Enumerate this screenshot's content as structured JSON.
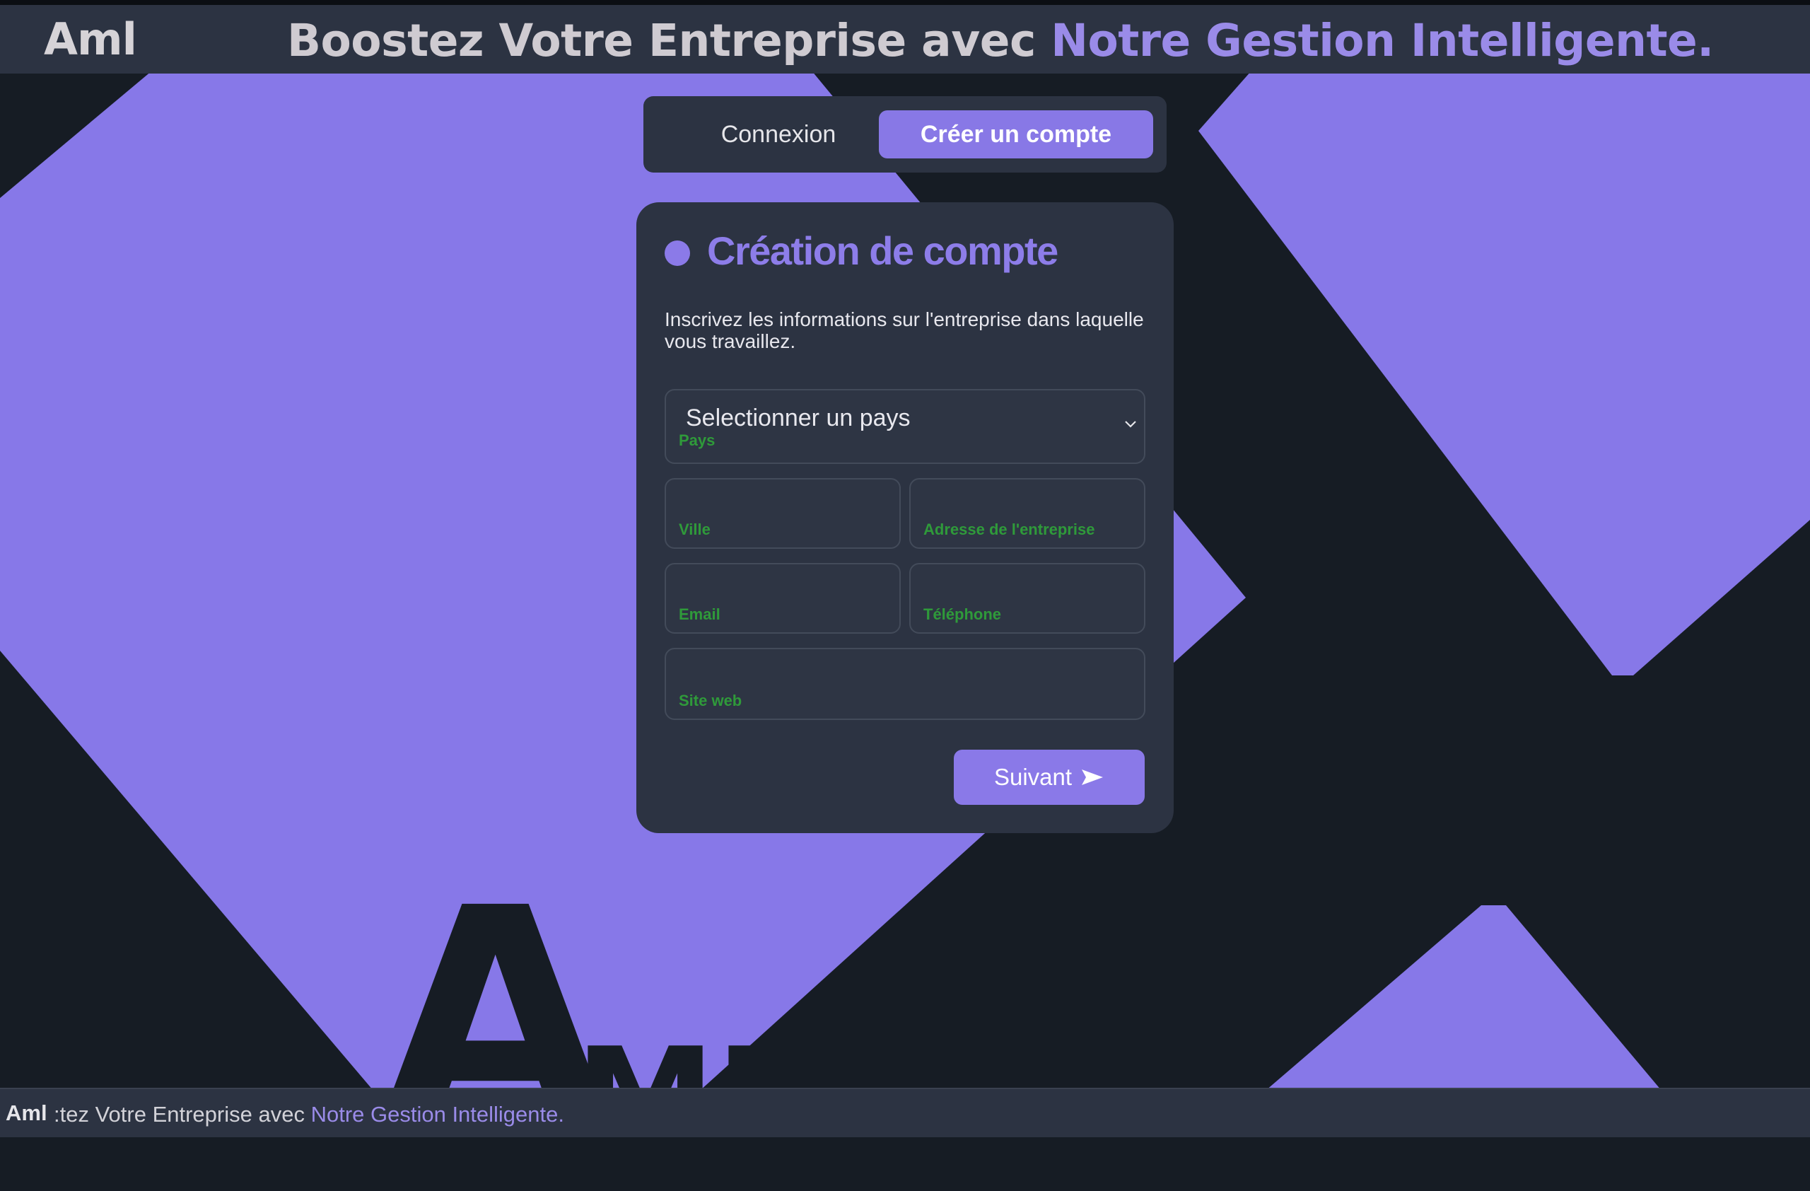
{
  "header": {
    "brand": "Aml",
    "headline_plain": "Boostez Votre Entreprise avec ",
    "headline_accent": "Notre Gestion Intelligente."
  },
  "tabs": [
    {
      "label": "Connexion",
      "active": false
    },
    {
      "label": "Créer un compte",
      "active": true
    }
  ],
  "form": {
    "title": "Création de compte",
    "description": "Inscrivez les informations sur l'entreprise dans laquelle vous travaillez.",
    "country": {
      "value": "Selectionner un pays",
      "label": "Pays"
    },
    "city": {
      "label": "Ville",
      "value": ""
    },
    "address": {
      "label": "Adresse de l'entreprise",
      "value": ""
    },
    "email": {
      "label": "Email",
      "value": ""
    },
    "phone": {
      "label": "Téléphone",
      "value": ""
    },
    "website": {
      "label": "Site web",
      "value": ""
    },
    "next_label": "Suivant"
  },
  "background_logo": {
    "big_letter": "A",
    "small_letters": "ML"
  },
  "footer": {
    "brand": "Aml",
    "text_plain": ":tez Votre Entreprise avec ",
    "text_accent": "Notre Gestion Intelligente."
  },
  "colors": {
    "accent": "#8878e6",
    "background": "#161c24",
    "panel": "#2c3342",
    "field_label": "#2f9a3a"
  },
  "icons": [
    "chevron-down-icon",
    "send-arrow-icon",
    "bullet-dot-icon"
  ]
}
